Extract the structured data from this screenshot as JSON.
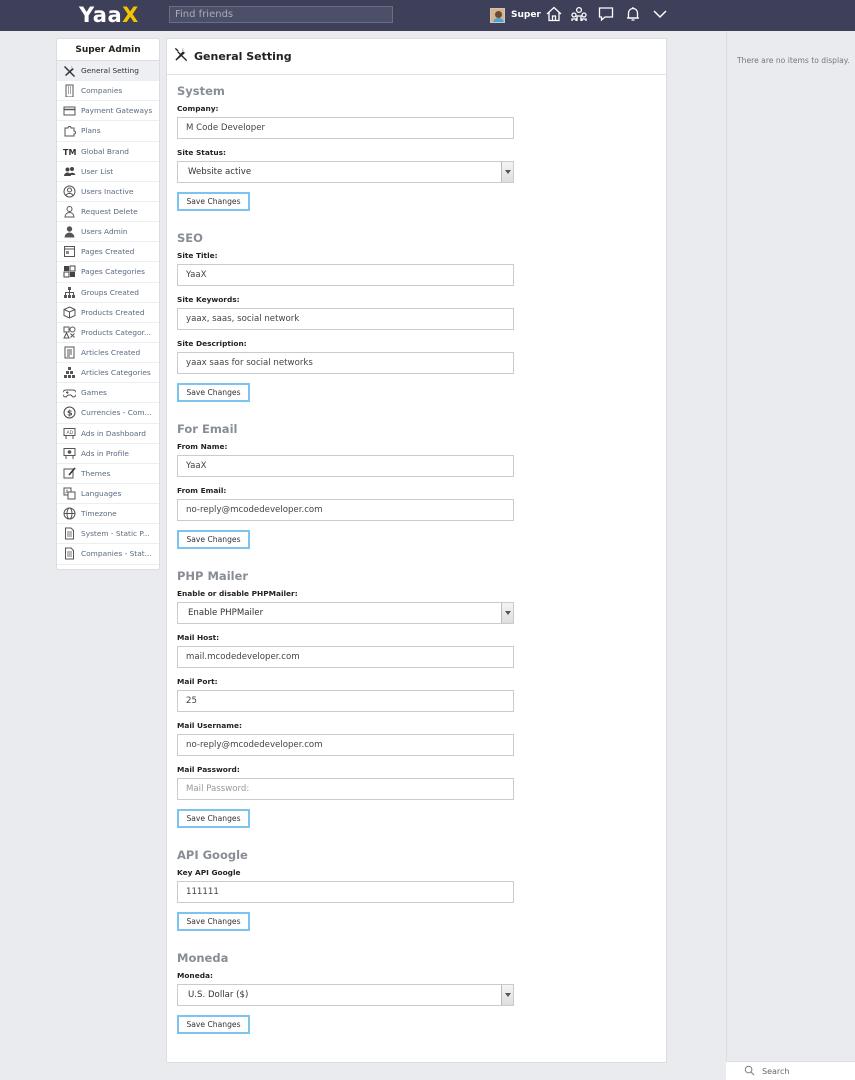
{
  "topbar": {
    "logo_main": "Yaa",
    "logo_accent": "X",
    "search_placeholder": "Find friends",
    "user_name": "Super"
  },
  "sidebar": {
    "title": "Super Admin",
    "items": [
      {
        "label": "General Setting",
        "icon": "wrench-icon"
      },
      {
        "label": "Companies",
        "icon": "building-icon"
      },
      {
        "label": "Payment Gateways",
        "icon": "credit-card-icon"
      },
      {
        "label": "Plans",
        "icon": "puzzle-icon"
      },
      {
        "label": "Global Brand",
        "icon": "trademark-icon"
      },
      {
        "label": "User List",
        "icon": "users-icon"
      },
      {
        "label": "Users Inactive",
        "icon": "user-circle-icon"
      },
      {
        "label": "Request Delete",
        "icon": "user-delete-icon"
      },
      {
        "label": "Users Admin",
        "icon": "user-admin-icon"
      },
      {
        "label": "Pages Created",
        "icon": "page-icon"
      },
      {
        "label": "Pages Categories",
        "icon": "grid-icon"
      },
      {
        "label": "Groups Created",
        "icon": "hierarchy-icon"
      },
      {
        "label": "Products Created",
        "icon": "box-icon"
      },
      {
        "label": "Products Categor...",
        "icon": "shapes-icon"
      },
      {
        "label": "Articles Created",
        "icon": "article-icon"
      },
      {
        "label": "Articles Categories",
        "icon": "pyramid-icon"
      },
      {
        "label": "Games",
        "icon": "gamepad-icon"
      },
      {
        "label": "Currencies - Com...",
        "icon": "dollar-icon"
      },
      {
        "label": "Ads in Dashboard",
        "icon": "billboard-icon"
      },
      {
        "label": "Ads in Profile",
        "icon": "billboard-profile-icon"
      },
      {
        "label": "Themes",
        "icon": "theme-icon"
      },
      {
        "label": "Languages",
        "icon": "translate-icon"
      },
      {
        "label": "Timezone",
        "icon": "globe-icon"
      },
      {
        "label": "System - Static P...",
        "icon": "document-icon"
      },
      {
        "label": "Companies - Stat...",
        "icon": "document-icon"
      }
    ]
  },
  "main": {
    "title": "General Setting",
    "save_label": "Save Changes",
    "system": {
      "title": "System",
      "company_label": "Company:",
      "company_value": "M Code Developer",
      "status_label": "Site Status:",
      "status_value": "Website active"
    },
    "seo": {
      "title": "SEO",
      "site_title_label": "Site Title:",
      "site_title_value": "YaaX",
      "keywords_label": "Site Keywords:",
      "keywords_value": "yaax, saas, social network",
      "description_label": "Site Description:",
      "description_value": "yaax saas for social networks"
    },
    "email": {
      "title": "For Email",
      "from_name_label": "From Name:",
      "from_name_value": "YaaX",
      "from_email_label": "From Email:",
      "from_email_value": "no-reply@mcodedeveloper.com"
    },
    "mailer": {
      "title": "PHP Mailer",
      "enable_label": "Enable or disable PHPMailer:",
      "enable_value": "Enable PHPMailer",
      "host_label": "Mail Host:",
      "host_value": "mail.mcodedeveloper.com",
      "port_label": "Mail Port:",
      "port_value": "25",
      "username_label": "Mail Username:",
      "username_value": "no-reply@mcodedeveloper.com",
      "password_label": "Mail Password:",
      "password_placeholder": "Mail Password:"
    },
    "google": {
      "title": "API Google",
      "key_label": "Key API Google",
      "key_value": "111111"
    },
    "moneda": {
      "title": "Moneda",
      "label": "Moneda:",
      "value": "U.S. Dollar ($)"
    }
  },
  "right": {
    "empty_text": "There are no items to display.",
    "search_label": "Search"
  },
  "colors": {
    "topbar": "#3d4058",
    "accent_logo": "#f5c400",
    "button_border": "#7cc3ee"
  }
}
